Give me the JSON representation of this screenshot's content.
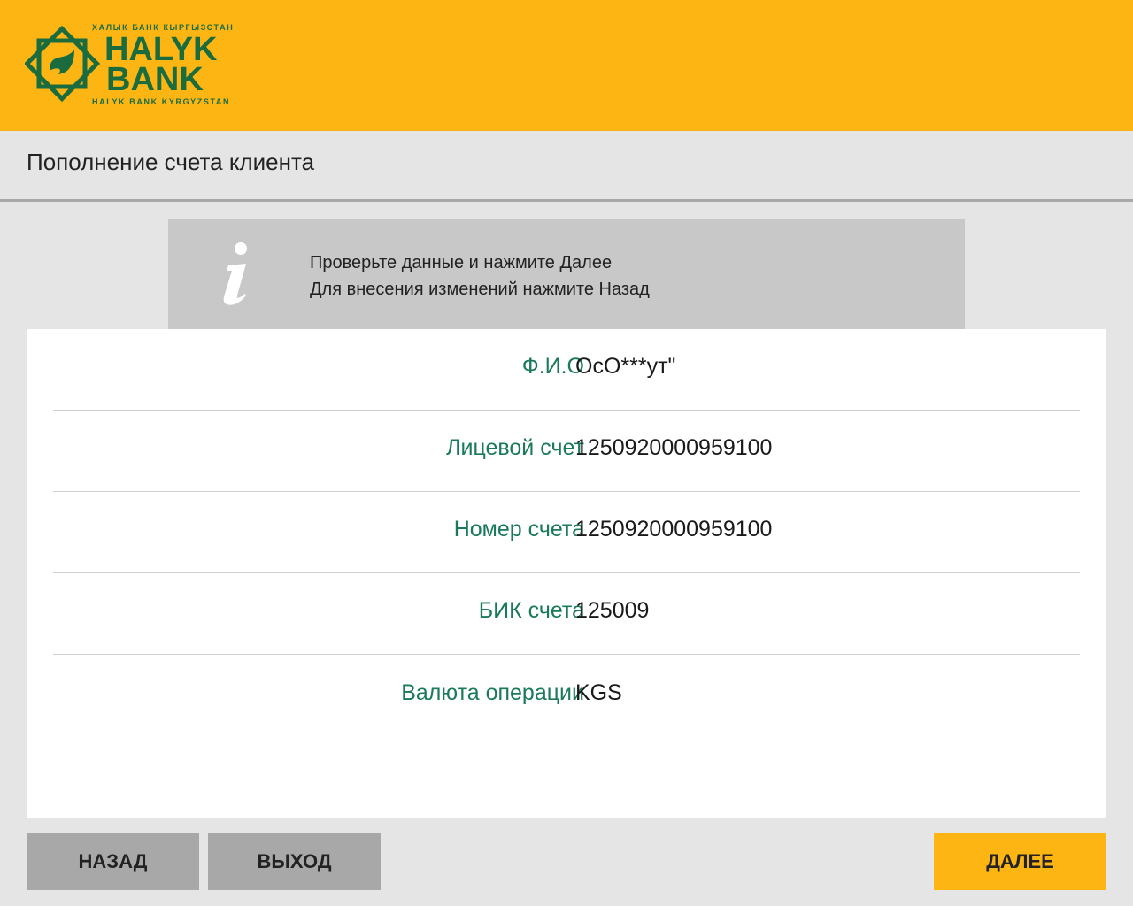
{
  "brand": {
    "top_text": "ХАЛЫК БАНК КЫРГЫЗСТАН",
    "name_line1": "HALYK",
    "name_line2": "BANK",
    "bottom_text": "HALYK BANK KYRGYZSTAN",
    "header_color": "#fdb514",
    "logo_color": "#1a6b3e"
  },
  "page": {
    "title": "Пополнение счета клиента"
  },
  "info": {
    "icon": "info-icon",
    "line1": "Проверьте данные и нажмите Далее",
    "line2": "Для внесения изменений нажмите Назад"
  },
  "details": [
    {
      "label": "Ф.И.О",
      "value": "ОсО***ут\""
    },
    {
      "label": "Лицевой счет",
      "value": "1250920000959100"
    },
    {
      "label": "Номер счета",
      "value": "1250920000959100"
    },
    {
      "label": "БИК счета",
      "value": "125009"
    },
    {
      "label": "Валюта операции",
      "value": "KGS"
    }
  ],
  "buttons": {
    "back": "НАЗАД",
    "exit": "ВЫХОД",
    "next": "ДАЛЕЕ"
  },
  "colors": {
    "label": "#1a7a5a",
    "accent": "#fdb514",
    "secondary_button": "#a8a8a8"
  }
}
